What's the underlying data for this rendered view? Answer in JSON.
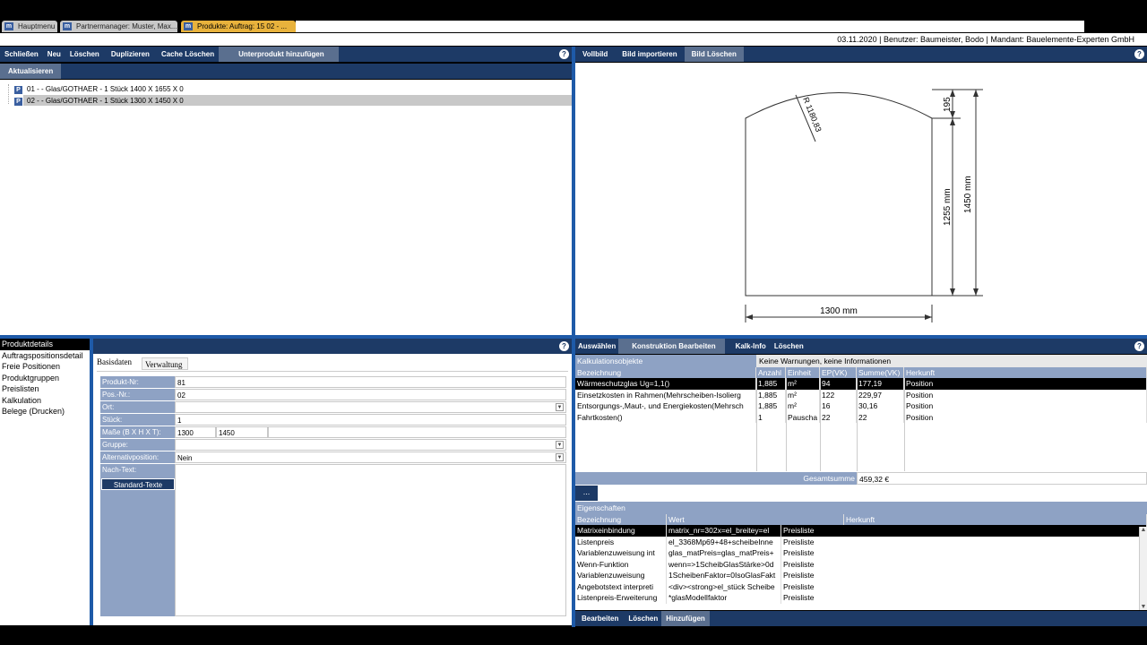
{
  "tabs": [
    {
      "label": "Hauptmenu",
      "icon": "app-icon"
    },
    {
      "label": "Partnermanager: Muster, Max...",
      "icon": "app-icon"
    },
    {
      "label": "Produkte: Auftrag: 15 02 - ...",
      "icon": "app-icon"
    }
  ],
  "status": "03.11.2020 | Benutzer: Baumeister, Bodo | Mandant: Bauelemente-Experten GmbH",
  "left_toolbar": [
    "Schließen",
    "Neu",
    "Löschen",
    "Duplizieren",
    "Cache Löschen",
    "Unterprodukt hinzufügen"
  ],
  "refresh_label": "Aktualisieren",
  "tree": [
    {
      "badge": "P",
      "label": "01 -  - Glas/GOTHAER - 1 Stück 1400 X 1655 X 0"
    },
    {
      "badge": "P",
      "label": "02 -  - Glas/GOTHAER - 1 Stück 1300 X 1450 X 0"
    }
  ],
  "right_toolbar": [
    "Vollbild",
    "Bild importieren",
    "Bild Löschen"
  ],
  "drawing": {
    "radius_label": "R 1180,83",
    "width_label": "1300 mm",
    "height_total_label": "1450 mm",
    "height_side_label": "1255 mm",
    "arc_height_label": "195"
  },
  "nav": [
    "Produktdetails",
    "Auftragspositionsdetail",
    "Freie Positionen",
    "Produktgruppen",
    "Preislisten",
    "Kalkulation",
    "Belege (Drucken)"
  ],
  "detail_tabs": [
    "Basisdaten",
    "Verwaltung"
  ],
  "form": [
    {
      "label": "Produkt-Nr:",
      "value": "81"
    },
    {
      "label": "Pos.-Nr.:",
      "value": "02"
    },
    {
      "label": "Ort:",
      "value": "",
      "dropdown": true
    },
    {
      "label": "Stück:",
      "value": "1"
    },
    {
      "label": "Maße (B X H X T):",
      "value": "1300",
      "value2": "1450",
      "value3": ""
    },
    {
      "label": "Gruppe:",
      "value": "",
      "dropdown": true
    },
    {
      "label": "Alternativposition:",
      "value": "Nein",
      "dropdown": true
    },
    {
      "label": "Nach-Text:",
      "value": ""
    }
  ],
  "standard_texte_label": "Standard-Texte",
  "calc_toolbar": [
    "Auswählen",
    "Konstruktion Bearbeiten",
    "Kalk-Info",
    "Löschen"
  ],
  "calc": {
    "section_title": "Kalkulationsobjekte",
    "warning": "Keine Warnungen, keine Informationen",
    "columns": [
      "Bezeichnung",
      "Anzahl",
      "Einheit",
      "EP(VK)",
      "Summe(VK)",
      "Herkunft"
    ],
    "rows": [
      [
        "Wärmeschutzglas Ug=1,1()",
        "1,885",
        "m²",
        "94",
        "177,19",
        "Position"
      ],
      [
        "Einsetzkosten in Rahmen(Mehrscheiben-Isolierg",
        "1,885",
        "m²",
        "122",
        "229,97",
        "Position"
      ],
      [
        "Entsorgungs-,Maut-, und Energiekosten(Mehrsch",
        "1,885",
        "m²",
        "16",
        "30,16",
        "Position"
      ],
      [
        "Fahrtkosten()",
        "1",
        "Pauscha",
        "22",
        "22",
        "Position"
      ]
    ],
    "total_label": "Gesamtsumme",
    "total_value": "459,32 €",
    "more_label": "..."
  },
  "props": {
    "section_title": "Eigenschaften",
    "columns": [
      "Bezeichnung",
      "Wert",
      "Herkunft"
    ],
    "rows": [
      [
        "Matrixeinbindung",
        "matrix_nr=302x=el_breitey=el",
        "Preisliste"
      ],
      [
        "Listenpreis",
        "el_3368Mp69+48+scheibeInne",
        "Preisliste"
      ],
      [
        "Variablenzuweisung int",
        "glas_matPreis=glas_matPreis+",
        "Preisliste"
      ],
      [
        "Wenn-Funktion",
        "wenn=>1ScheibGlasStärke>0d",
        "Preisliste"
      ],
      [
        "Variablenzuweisung",
        "1ScheibenFaktor=0IsoGlasFakt",
        "Preisliste"
      ],
      [
        "Angebotstext interpreti",
        "<div><strong>el_stück Scheibe",
        "Preisliste"
      ],
      [
        "Listenpreis-Erweiterung",
        "*glasModellfaktor",
        "Preisliste"
      ]
    ]
  },
  "bottom_toolbar": [
    "Bearbeiten",
    "Löschen",
    "Hinzufügen"
  ],
  "colors": {
    "toolbar": "#1d3a66",
    "label_bg": "#8ea2c4",
    "active_tab": "#e8b23c",
    "divider": "#1e5aa8"
  }
}
